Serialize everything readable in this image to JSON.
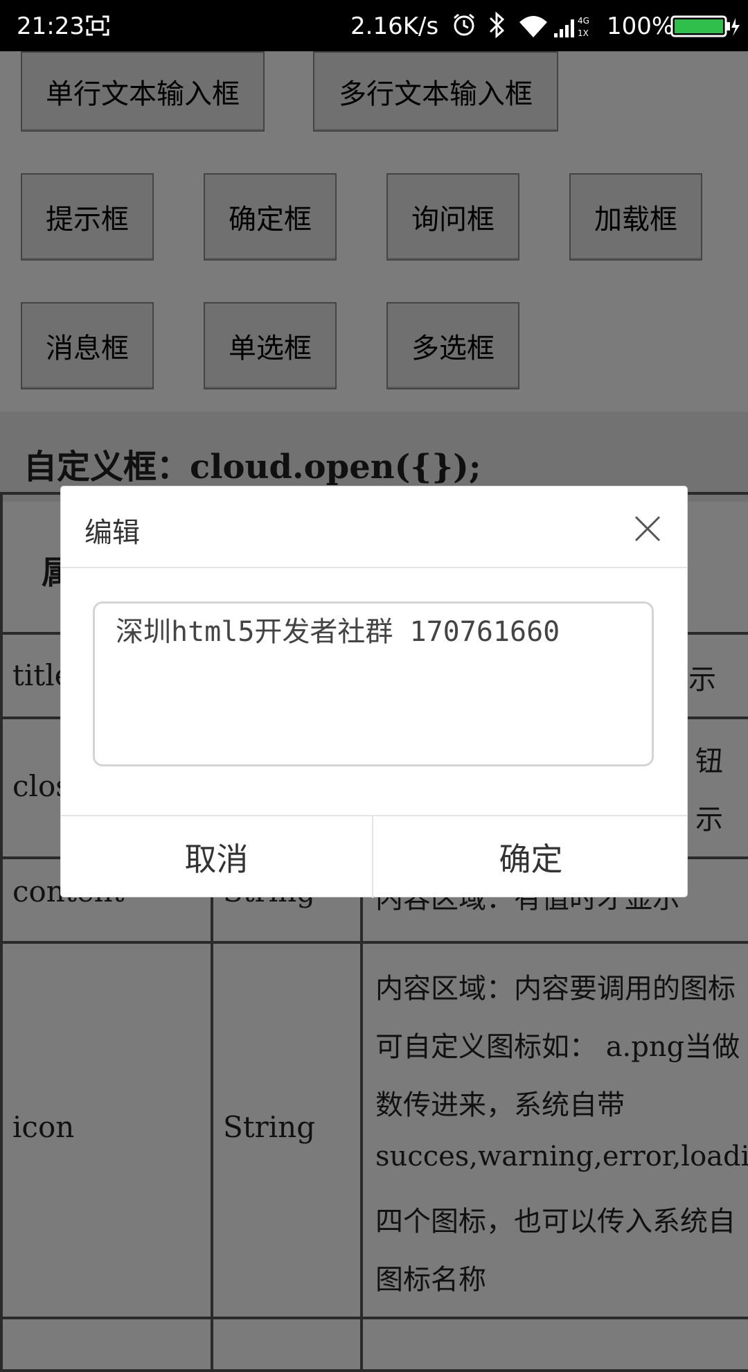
{
  "status_bar": {
    "time": "21:23",
    "net_speed": "2.16K/s",
    "battery": "100%",
    "network": "4G 1X"
  },
  "buttons_row1": [
    "单行文本输入框",
    "多行文本输入框"
  ],
  "buttons_row2": [
    "提示框",
    "确定框",
    "询问框",
    "加载框"
  ],
  "buttons_row3": [
    "消息框",
    "单选框",
    "多选框"
  ],
  "section_title": "自定义框：cloud.open({});",
  "table": {
    "header_partial": "属",
    "rows": [
      {
        "name": "title",
        "type": "",
        "desc_partial": "示"
      },
      {
        "name": "close",
        "type": "",
        "desc_partial": "钮",
        "desc_partial2": "示"
      },
      {
        "name": "content",
        "type": "String",
        "desc": "内容区域：有值时才显示"
      },
      {
        "name": "icon",
        "type": "String",
        "desc_lines": [
          "内容区域：内容要调用的图标",
          "可自定义图标如： a.png当做",
          "数传进来，系统自带",
          "succes,warning,error,loading",
          "四个图标，也可以传入系统自",
          "图标名称"
        ]
      }
    ]
  },
  "dialog": {
    "title": "编辑",
    "textarea_value": "深圳html5开发者社群 170761660",
    "cancel_label": "取消",
    "ok_label": "确定"
  },
  "colors": {
    "overlay_bg": "#7b7b7b",
    "dialog_bg": "#ffffff",
    "status_bar_bg": "#000000"
  }
}
